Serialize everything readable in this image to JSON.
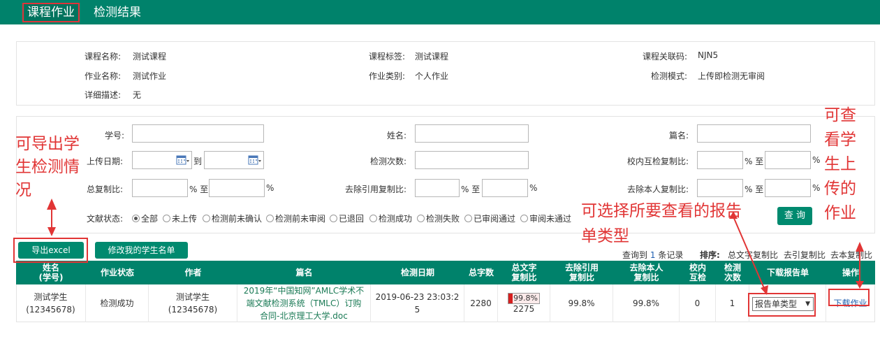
{
  "tabs": [
    "课程作业",
    "检测结果"
  ],
  "info": {
    "course_name_label": "课程名称:",
    "course_name": "测试课程",
    "course_tag_label": "课程标签:",
    "course_tag": "测试课程",
    "course_code_label": "课程关联码:",
    "course_code": "NJN5",
    "hw_name_label": "作业名称:",
    "hw_name": "测试作业",
    "hw_type_label": "作业类别:",
    "hw_type": "个人作业",
    "detect_mode_label": "检测模式:",
    "detect_mode": "上传即检测无审阅",
    "desc_label": "详细描述:",
    "desc": "无"
  },
  "filters": {
    "student_id": "学号:",
    "name": "姓名:",
    "title": "篇名:",
    "upload_date": "上传日期:",
    "to": "到",
    "detect_count": "检测次数:",
    "intra_ratio": "校内互检复制比:",
    "total_ratio": "总复制比:",
    "excl_ref_ratio": "去除引用复制比:",
    "excl_self_ratio": "去除本人复制比:",
    "percent": "%",
    "percent_to": "% 至",
    "status_label": "文献状态:",
    "status_options": [
      "全部",
      "未上传",
      "检测前未确认",
      "检测前未审阅",
      "已退回",
      "检测成功",
      "检测失败",
      "已审阅通过",
      "审阅未通过"
    ],
    "query_button": "查 询"
  },
  "actions": {
    "export_excel": "导出excel",
    "edit_roster": "修改我的学生名单"
  },
  "result_summary": {
    "prefix": "查询到",
    "count": "1",
    "suffix": "条记录",
    "sort_label": "排序:",
    "sort_options": [
      "总文字复制比",
      "去引复制比",
      "去本复制比"
    ]
  },
  "table": {
    "headers": [
      "姓名\n(学号)",
      "作业状态",
      "作者",
      "篇名",
      "检测日期",
      "总字数",
      "总文字\n复制比",
      "去除引用\n复制比",
      "去除本人\n复制比",
      "校内\n互检",
      "检测\n次数",
      "下载报告单",
      "操作"
    ],
    "row": {
      "name": "测试学生\n(12345678)",
      "status": "检测成功",
      "author": "测试学生\n(12345678)",
      "title": "2019年“中国知网”AMLC学术不端文献检测系统（TMLC）订购合同-北京理工大学.doc",
      "date": "2019-06-23 23:03:25",
      "word_count": "2280",
      "total_ratio": "99.8%",
      "total_ratio_value": 99.8,
      "total_ratio_words": "2275",
      "excl_ref_ratio": "99.8%",
      "excl_self_ratio": "99.8%",
      "intra": "0",
      "detect_times": "1",
      "report_select": "报告单类型",
      "action": "下载作业"
    }
  },
  "annotations": {
    "export": "可导出学生检测情况",
    "report": "可选择所要查看的报告单类型",
    "view": "可查看学生上传的作业"
  },
  "colors": {
    "brand": "#00826b",
    "annotation": "#e13535"
  }
}
